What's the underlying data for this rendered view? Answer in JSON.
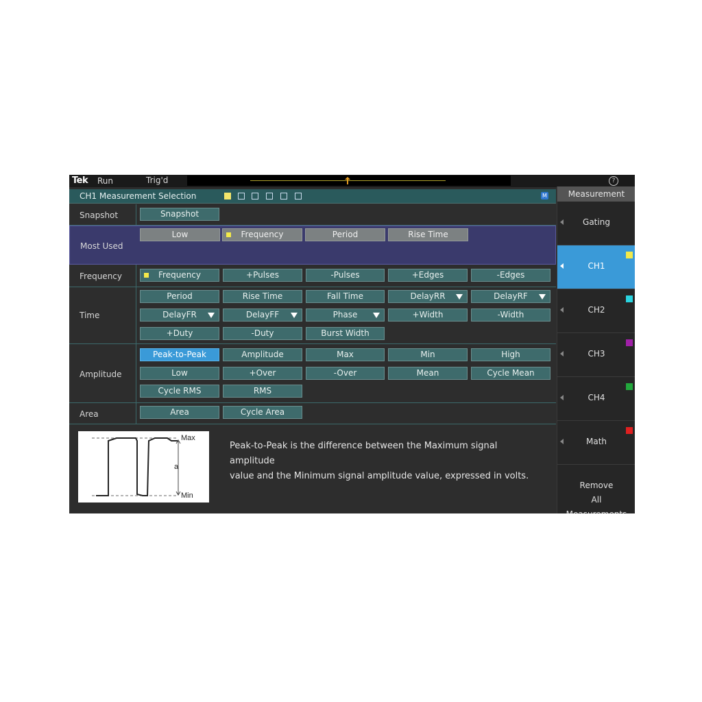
{
  "topbar": {
    "logo": "Tek",
    "run": "Run",
    "trig": "Trig'd",
    "help_icon": "help-icon"
  },
  "header": {
    "title": "CH1 Measurement Selection",
    "m_badge": "M"
  },
  "rows": {
    "snapshot": {
      "label": "Snapshot",
      "buttons": [
        "Snapshot"
      ]
    },
    "most_used": {
      "label": "Most Used",
      "buttons": [
        "Low",
        "Frequency",
        "Period",
        "Rise Time"
      ]
    },
    "frequency": {
      "label": "Frequency",
      "buttons": [
        "Frequency",
        "+Pulses",
        "-Pulses",
        "+Edges",
        "-Edges"
      ]
    },
    "time": {
      "label": "Time",
      "buttons": [
        "Period",
        "Rise Time",
        "Fall Time",
        "DelayRR",
        "DelayRF",
        "DelayFR",
        "DelayFF",
        "Phase",
        "+Width",
        "-Width",
        "+Duty",
        "-Duty",
        "Burst Width"
      ]
    },
    "amplitude": {
      "label": "Amplitude",
      "buttons": [
        "Peak-to-Peak",
        "Amplitude",
        "Max",
        "Min",
        "High",
        "Low",
        "+Over",
        "-Over",
        "Mean",
        "Cycle Mean",
        "Cycle RMS",
        "RMS"
      ]
    },
    "area": {
      "label": "Area",
      "buttons": [
        "Area",
        "Cycle Area"
      ]
    }
  },
  "description": {
    "line1": "Peak-to-Peak is the difference between the Maximum signal amplitude",
    "line2": "value and the Minimum signal amplitude value, expressed in volts.",
    "diagram": {
      "max": "Max",
      "min": "Min",
      "a": "a"
    }
  },
  "sidebar": {
    "header": "Measurement",
    "items": [
      {
        "label": "Gating"
      },
      {
        "label": "CH1",
        "color": "#f3e94a"
      },
      {
        "label": "CH2",
        "color": "#2ad4e0"
      },
      {
        "label": "CH3",
        "color": "#a020a8"
      },
      {
        "label": "CH4",
        "color": "#22a83c"
      },
      {
        "label": "Math",
        "color": "#e02020"
      }
    ],
    "remove": {
      "line1": "Remove",
      "line2": "All",
      "line3": "Measurements"
    }
  },
  "colors": {
    "accent_selected": "#3a9ad8",
    "button": "#3e6b6c",
    "most_used_bg": "#3a3a6c"
  }
}
